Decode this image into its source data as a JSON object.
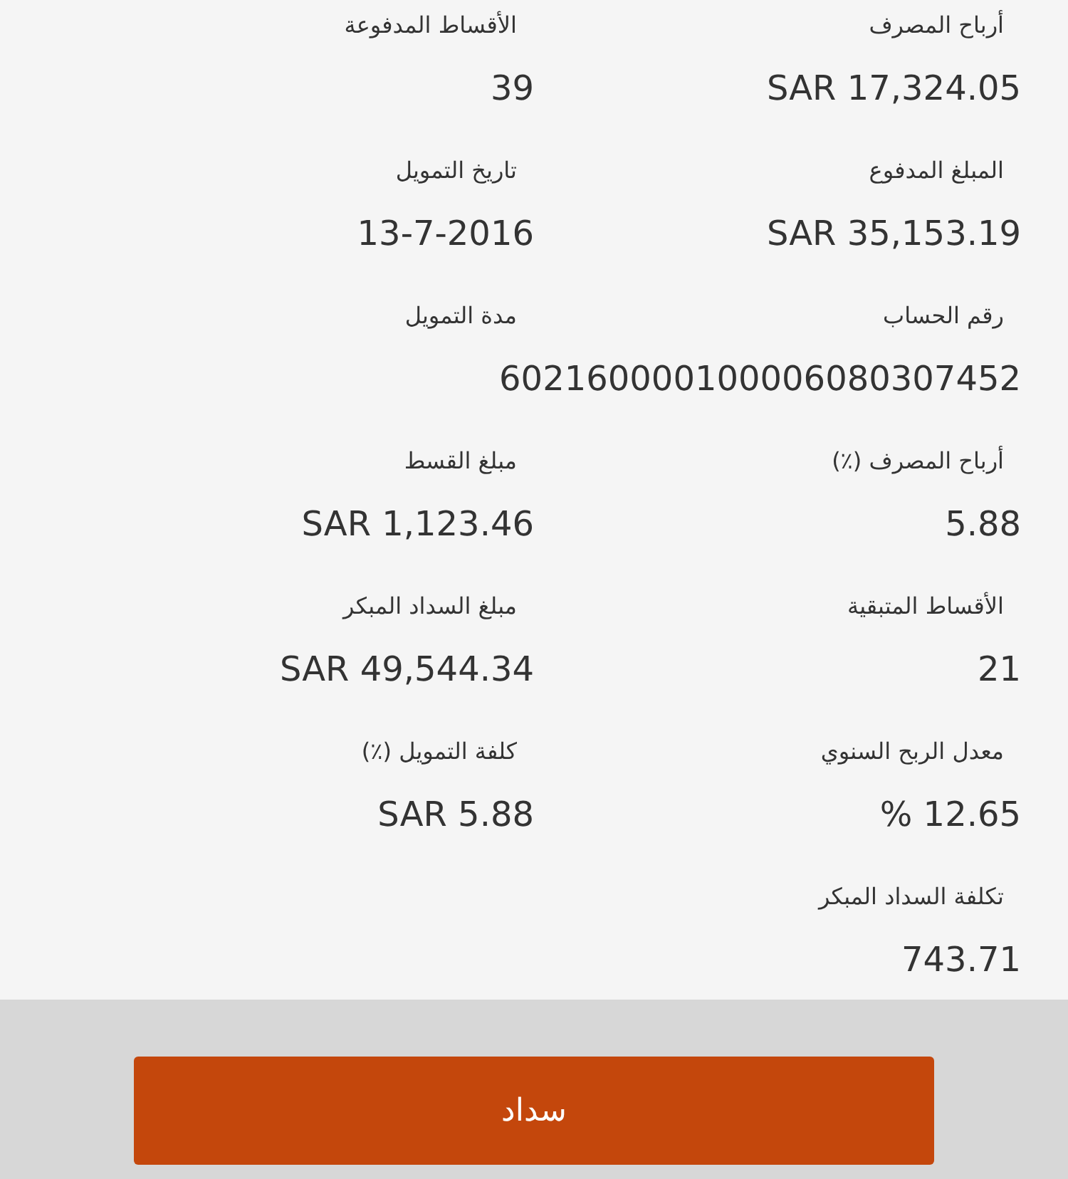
{
  "fields": [
    {
      "label": "أرباح المصرف",
      "value": "SAR 17,324.05"
    },
    {
      "label": "الأقساط المدفوعة",
      "value": "39"
    },
    {
      "label": "المبلغ المدفوع",
      "value": "SAR 35,153.19"
    },
    {
      "label": "تاريخ التمويل",
      "value": "13-7-2016"
    },
    {
      "label": "رقم الحساب",
      "value": "602160000100006080307452"
    },
    {
      "label": "مدة التمويل"
    },
    {
      "label": "أرباح المصرف (٪)",
      "value": "5.88"
    },
    {
      "label": "مبلغ القسط",
      "value": "SAR 1,123.46"
    },
    {
      "label": "الأقساط المتبقية",
      "value": "21"
    },
    {
      "label": "مبلغ السداد المبكر",
      "value": "SAR 49,544.34"
    },
    {
      "label": "معدل الربح السنوي",
      "value": "% 12.65"
    },
    {
      "label": "كلفة التمويل (٪)",
      "value": "SAR 5.88"
    },
    {
      "label": "تكلفة السداد المبكر",
      "value": "743.71"
    }
  ],
  "pay_button": "سداد"
}
